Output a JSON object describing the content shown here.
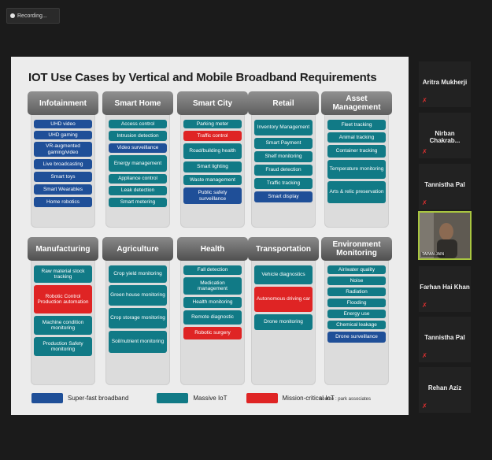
{
  "recording": {
    "label": "Recording..."
  },
  "slide": {
    "title": "IOT Use Cases by Vertical and Mobile Broadband Requirements",
    "legend": [
      {
        "label": "Super-fast broadband",
        "color": "#1f4f98"
      },
      {
        "label": "Massive IoT",
        "color": "#117a86"
      },
      {
        "label": "Mission-critical IoT",
        "color": "#df2424"
      }
    ],
    "source": "Source : park associates",
    "columns": [
      {
        "title": "Infotainment",
        "items": [
          {
            "label": "UHD video",
            "type": "blue"
          },
          {
            "label": "UHD gaming",
            "type": "blue"
          },
          {
            "label": "VR-augmented gaming/video",
            "type": "blue"
          },
          {
            "label": "Live broadcasting",
            "type": "blue"
          },
          {
            "label": "Smart toys",
            "type": "blue"
          },
          {
            "label": "Smart Wearables",
            "type": "blue"
          },
          {
            "label": "Home robotics",
            "type": "blue"
          }
        ]
      },
      {
        "title": "Smart Home",
        "items": [
          {
            "label": "Access control",
            "type": "teal"
          },
          {
            "label": "Intrusion detection",
            "type": "teal"
          },
          {
            "label": "Video surveillance",
            "type": "blue"
          },
          {
            "label": "Energy management",
            "type": "teal"
          },
          {
            "label": "Appliance control",
            "type": "teal"
          },
          {
            "label": "Leak detection",
            "type": "teal"
          },
          {
            "label": "Smart metering",
            "type": "teal"
          }
        ]
      },
      {
        "title": "Smart City",
        "items": [
          {
            "label": "Parking meter",
            "type": "teal"
          },
          {
            "label": "Traffic control",
            "type": "red"
          },
          {
            "label": "Road/building health",
            "type": "teal"
          },
          {
            "label": "Smart lighting",
            "type": "teal"
          },
          {
            "label": "Waste management",
            "type": "teal"
          },
          {
            "label": "Public safety surveillance",
            "type": "blue"
          }
        ]
      },
      {
        "title": "Retail",
        "items": [
          {
            "label": "Inventory Management",
            "type": "teal"
          },
          {
            "label": "Smart Payment",
            "type": "teal"
          },
          {
            "label": "Shelf monitoring",
            "type": "teal"
          },
          {
            "label": "Fraud detection",
            "type": "teal"
          },
          {
            "label": "Traffic tracking",
            "type": "teal"
          },
          {
            "label": "Smart display",
            "type": "blue"
          }
        ]
      },
      {
        "title": "Asset Management",
        "items": [
          {
            "label": "Fleet tracking",
            "type": "teal"
          },
          {
            "label": "Animal tracking",
            "type": "teal"
          },
          {
            "label": "Container tracking",
            "type": "teal"
          },
          {
            "label": "Temperature monitoring",
            "type": "teal"
          },
          {
            "label": "Arts & relic preservation",
            "type": "teal"
          }
        ]
      },
      {
        "title": "Manufacturing",
        "items": [
          {
            "label": "Raw material stock tracking",
            "type": "teal"
          },
          {
            "label": "Robotic Control Production automation",
            "type": "red"
          },
          {
            "label": "Machine condition monitoring",
            "type": "teal"
          },
          {
            "label": "Production Safety monitoring",
            "type": "teal"
          }
        ]
      },
      {
        "title": "Agriculture",
        "items": [
          {
            "label": "Crop yield monitoring",
            "type": "teal"
          },
          {
            "label": "Green house monitoring",
            "type": "teal"
          },
          {
            "label": "Crop storage monitoring",
            "type": "teal"
          },
          {
            "label": "Soil/nutrient monitoring",
            "type": "teal"
          }
        ]
      },
      {
        "title": "Health",
        "items": [
          {
            "label": "Fall detection",
            "type": "teal"
          },
          {
            "label": "Medication management",
            "type": "teal"
          },
          {
            "label": "Health monitoring",
            "type": "teal"
          },
          {
            "label": "Remote diagnostic",
            "type": "teal"
          },
          {
            "label": "Robotic surgery",
            "type": "red"
          }
        ]
      },
      {
        "title": "Transportation",
        "items": [
          {
            "label": "Vehicle diagnostics",
            "type": "teal"
          },
          {
            "label": "Autonomous driving car",
            "type": "red"
          },
          {
            "label": "Drone monitoring",
            "type": "teal"
          }
        ]
      },
      {
        "title": "Environment Monitoring",
        "items": [
          {
            "label": "Air/water quality",
            "type": "teal"
          },
          {
            "label": "Noise",
            "type": "teal"
          },
          {
            "label": "Radiation",
            "type": "teal"
          },
          {
            "label": "Flooding",
            "type": "teal"
          },
          {
            "label": "Energy use",
            "type": "teal"
          },
          {
            "label": "Chemical leakage",
            "type": "teal"
          },
          {
            "label": "Drone surveillance",
            "type": "blue"
          }
        ]
      }
    ]
  },
  "participants": [
    {
      "name": "Aritra Mukherji"
    },
    {
      "name": "Nirban Chakrab..."
    },
    {
      "name": "Tannistha Pal"
    },
    {
      "name": "Farhan Hai Khan"
    },
    {
      "name": "Tannistha Pal"
    },
    {
      "name": "Rehan Aziz"
    }
  ],
  "video_participant": {
    "label": "TAPAN JAIN"
  }
}
